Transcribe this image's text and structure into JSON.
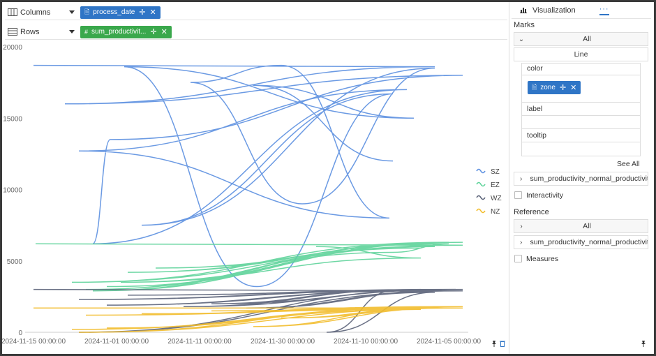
{
  "shelves": {
    "columns": {
      "label": "Columns",
      "field": "process_date"
    },
    "rows": {
      "label": "Rows",
      "field": "sum_productivit..."
    }
  },
  "panel": {
    "tab_label": "Visualization",
    "tab_more": "···",
    "marks_title": "Marks",
    "all_label": "All",
    "mark_type": "Line",
    "color_label": "color",
    "color_field": "zone",
    "label_label": "label",
    "tooltip_label": "tooltip",
    "see_all": "See All",
    "measure_row": "sum_productivity_normal_productivity",
    "interactivity": "Interactivity",
    "reference_title": "Reference",
    "ref_all": "All",
    "ref_measure": "sum_productivity_normal_productivity",
    "measures": "Measures"
  },
  "colors": {
    "SZ": "#5b8fe0",
    "EZ": "#5ed39a",
    "WZ": "#5a6278",
    "NZ": "#f2bd2c",
    "pill_blue": "#2f75c6",
    "pill_green": "#3aa84c"
  },
  "chart_data": {
    "type": "line",
    "y_ticks": [
      "20000",
      "15000",
      "10000",
      "5000",
      "0"
    ],
    "x_ticks": [
      "2024-11-15 00:00:00",
      "2024-11-01 00:00:00",
      "2024-11-11 00:00:00",
      "2024-11-30 00:00:00",
      "2024-11-10 00:00:00",
      "2024-11-05 00:00:00"
    ],
    "ylim": [
      0,
      20000
    ],
    "legend_position": "right",
    "series": [
      {
        "name": "SZ",
        "values": [
          18700,
          18600,
          16000,
          18000,
          13500,
          6200,
          17000,
          12700,
          8000,
          18700,
          17500,
          9000,
          18500,
          7500,
          16700,
          3200,
          18600,
          15000,
          17300,
          12000
        ]
      },
      {
        "name": "EZ",
        "values": [
          6200,
          6100,
          3500,
          6300,
          3000,
          5900,
          4200,
          6300,
          3200,
          6000,
          2900,
          5600,
          6200,
          4500,
          6300,
          3500,
          5200,
          6000
        ]
      },
      {
        "name": "WZ",
        "values": [
          3000,
          2900,
          0,
          3000,
          1900,
          2900,
          2300,
          3000,
          1700,
          2800,
          0,
          2900,
          2000,
          3000,
          2600,
          3000,
          1800,
          3000
        ]
      },
      {
        "name": "NZ",
        "values": [
          1700,
          1700,
          0,
          1800,
          300,
          1600,
          1200,
          1800,
          200,
          1700,
          1000,
          1800,
          1300,
          1700,
          400,
          1600,
          1500,
          1700
        ]
      }
    ]
  }
}
